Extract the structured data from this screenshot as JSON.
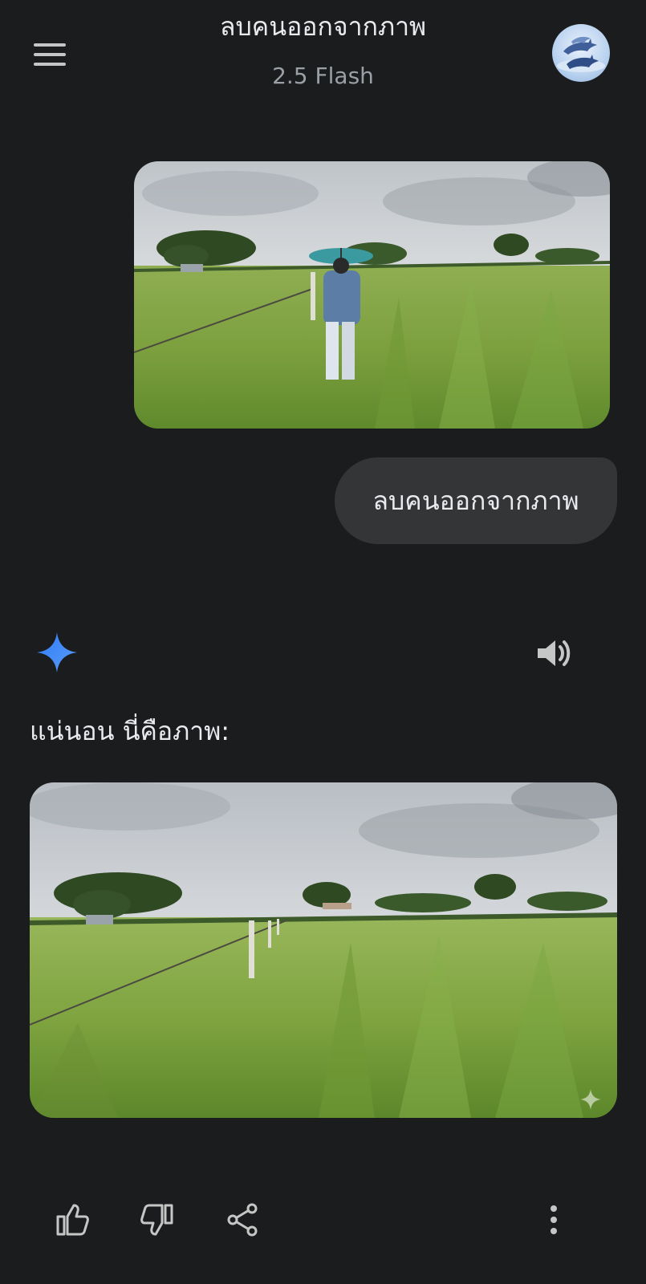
{
  "header": {
    "title": "ลบคนออกจากภาพ",
    "subtitle": "2.5 Flash",
    "menu_icon": "hamburger-menu-icon",
    "avatar_icon": "dolphin-avatar"
  },
  "conversation": {
    "user_message": "ลบคนออกจากภาพ",
    "user_image": "photo of a man with a teal umbrella walking along a fence in a green rice field",
    "response_text": "แน่นอน นี่คือภาพ:",
    "response_image": "edited photo of the same rice field with the person removed"
  },
  "actions": {
    "icons": [
      "thumb-up-icon",
      "thumb-down-icon",
      "share-icon",
      "more-vert-icon"
    ]
  },
  "colors": {
    "background": "#1b1c1e",
    "bubble": "#333537",
    "gemini_blue": "#4a8cf7",
    "text": "#e8eaed",
    "muted": "#9aa0a6"
  }
}
